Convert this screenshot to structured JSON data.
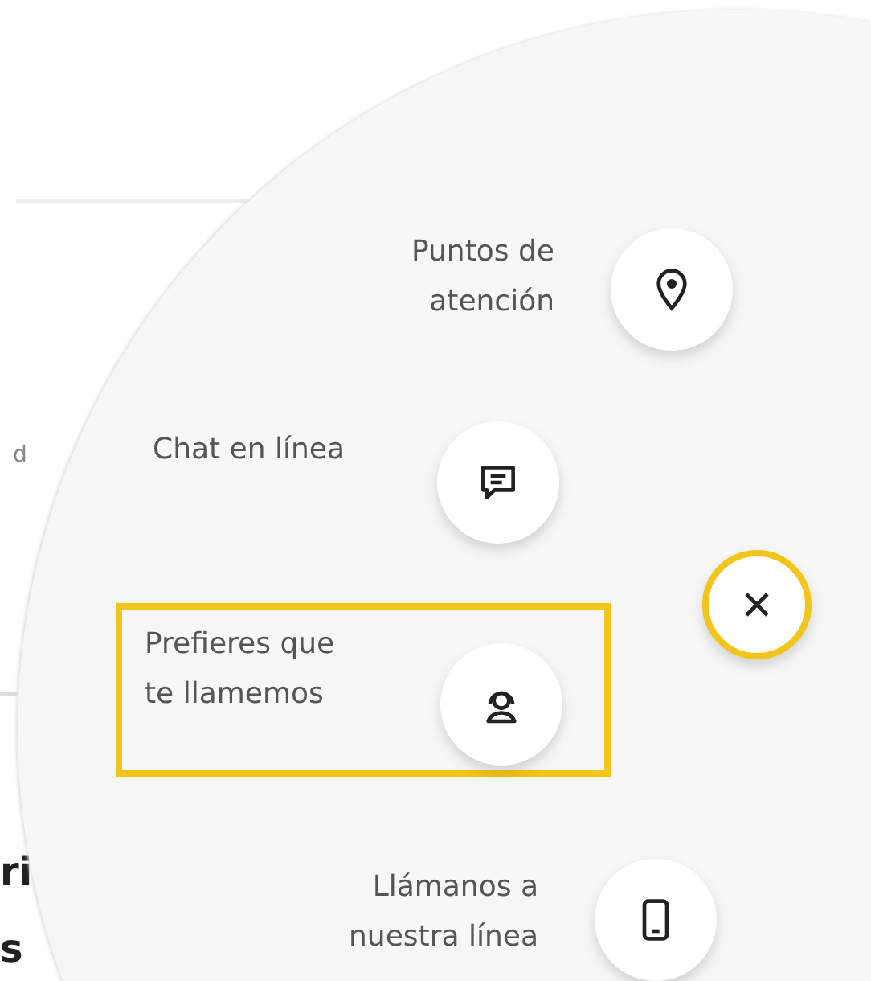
{
  "page_behind": {
    "fragments": [
      {
        "text": "d",
        "kind": "small"
      },
      {
        "text": "ri",
        "kind": "heading"
      },
      {
        "text": "s",
        "kind": "heading"
      }
    ]
  },
  "contact_menu": {
    "items": [
      {
        "label": "Puntos de\natención",
        "kind": "location",
        "highlighted": false
      },
      {
        "label": "Chat en línea",
        "kind": "chat",
        "highlighted": false
      },
      {
        "label": "Prefieres que\nte llamemos",
        "kind": "callback",
        "highlighted": true
      },
      {
        "label": "Llámanos a\nnuestra línea",
        "kind": "phone",
        "highlighted": false
      }
    ],
    "close_button": {
      "kind": "close"
    }
  }
}
